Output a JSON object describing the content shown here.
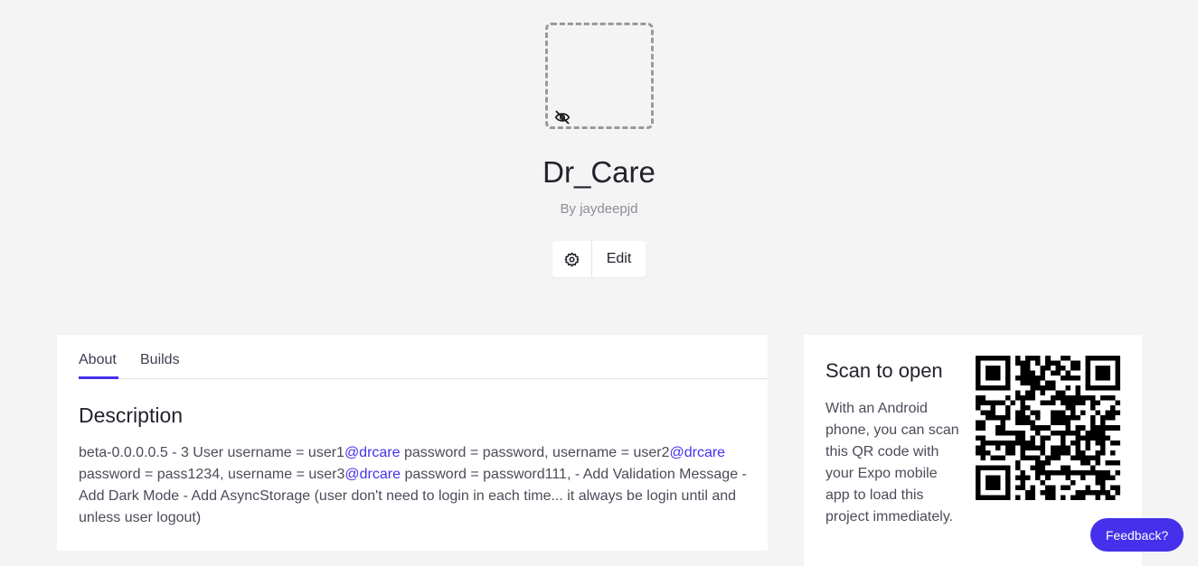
{
  "app": {
    "title": "Dr_Care",
    "author": "By jaydeepjd",
    "icon_state": "eye-slash-icon"
  },
  "actions": {
    "settings_icon": "gear-icon",
    "edit_label": "Edit"
  },
  "tabs": [
    {
      "label": "About",
      "active": true
    },
    {
      "label": "Builds",
      "active": false
    }
  ],
  "description": {
    "title": "Description",
    "parts": [
      {
        "text": "beta-0.0.0.0.5 - 3 User username = user1",
        "mention": false
      },
      {
        "text": "@drcare",
        "mention": true
      },
      {
        "text": " password = password, username = user2",
        "mention": false
      },
      {
        "text": "@drcare",
        "mention": true
      },
      {
        "text": " password = pass1234, username = user3",
        "mention": false
      },
      {
        "text": "@drcare",
        "mention": true
      },
      {
        "text": " password = password111, - Add Validation Message - Add Dark Mode - Add AsyncStorage (user don't need to login in each time... it always be login until and unless user logout)",
        "mention": false
      }
    ]
  },
  "qr": {
    "title": "Scan to open",
    "text": "With an Android phone, you can scan this QR code with your Expo mobile app to load this project immediately."
  },
  "feedback": {
    "label": "Feedback?"
  },
  "colors": {
    "accent": "#4630eb",
    "background": "#f4f4f5"
  }
}
